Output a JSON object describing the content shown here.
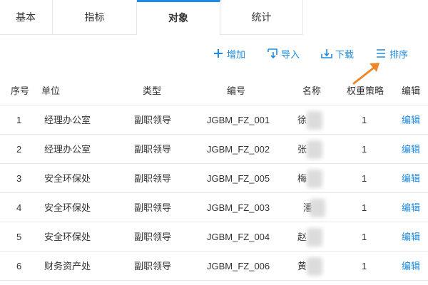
{
  "tabs": [
    {
      "label": "基本"
    },
    {
      "label": "指标"
    },
    {
      "label": "对象",
      "active": true
    },
    {
      "label": "统计"
    }
  ],
  "toolbar": {
    "add_label": "增加",
    "import_label": "导入",
    "download_label": "下载",
    "sort_label": "排序"
  },
  "colors": {
    "accent": "#1e8be0",
    "annotation_arrow": "#f0862a",
    "border": "#e4e7ed"
  },
  "table": {
    "headers": {
      "index": "序号",
      "unit": "单位",
      "type": "类型",
      "code": "编号",
      "name": "名称",
      "weight": "权重策略",
      "edit": "编辑"
    },
    "rows": [
      {
        "index": "1",
        "unit": "经理办公室",
        "type": "副职领导",
        "code": "JGBM_FZ_001",
        "name": "徐",
        "weight": "1",
        "edit": "编辑"
      },
      {
        "index": "2",
        "unit": "经理办公室",
        "type": "副职领导",
        "code": "JGBM_FZ_002",
        "name": "张",
        "weight": "1",
        "edit": "编辑"
      },
      {
        "index": "3",
        "unit": "安全环保处",
        "type": "副职领导",
        "code": "JGBM_FZ_005",
        "name": "梅",
        "weight": "1",
        "edit": "编辑"
      },
      {
        "index": "4",
        "unit": "安全环保处",
        "type": "副职领导",
        "code": "JGBM_FZ_003",
        "name": "潘",
        "weight": "1",
        "edit": "编辑"
      },
      {
        "index": "5",
        "unit": "安全环保处",
        "type": "副职领导",
        "code": "JGBM_FZ_004",
        "name": "赵",
        "weight": "1",
        "edit": "编辑"
      },
      {
        "index": "6",
        "unit": "财务资产处",
        "type": "副职领导",
        "code": "JGBM_FZ_006",
        "name": "黄",
        "weight": "1",
        "edit": "编辑"
      }
    ]
  }
}
